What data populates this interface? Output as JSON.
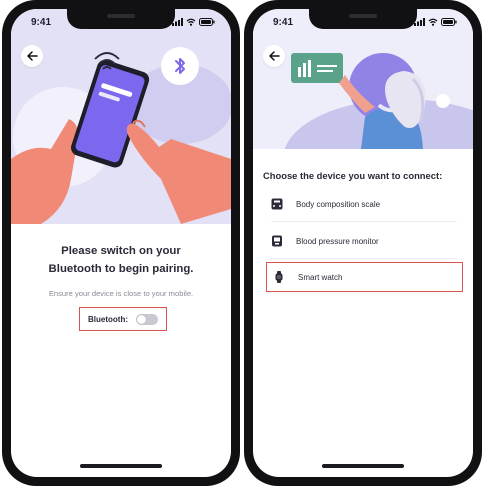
{
  "left_screen": {
    "status_time": "9:41",
    "title_line1": "Please switch on your",
    "title_line2": "Bluetooth to begin pairing.",
    "subtitle": "Ensure your device is close to your mobile.",
    "bluetooth_label": "Bluetooth:",
    "bluetooth_enabled": false
  },
  "right_screen": {
    "status_time": "9:41",
    "prompt": "Choose the device you want to connect:",
    "devices": [
      {
        "label": "Body composition scale",
        "icon": "scale-icon",
        "selected": false
      },
      {
        "label": "Blood pressure monitor",
        "icon": "blood-pressure-icon",
        "selected": false
      },
      {
        "label": "Smart watch",
        "icon": "smartwatch-icon",
        "selected": true
      }
    ]
  },
  "colors": {
    "accent_purple": "#7b68ee",
    "hero_background": "#e3e1f6",
    "skin": "#f08a76",
    "highlight_border": "#d9534f",
    "card_green": "#5aa38a"
  }
}
